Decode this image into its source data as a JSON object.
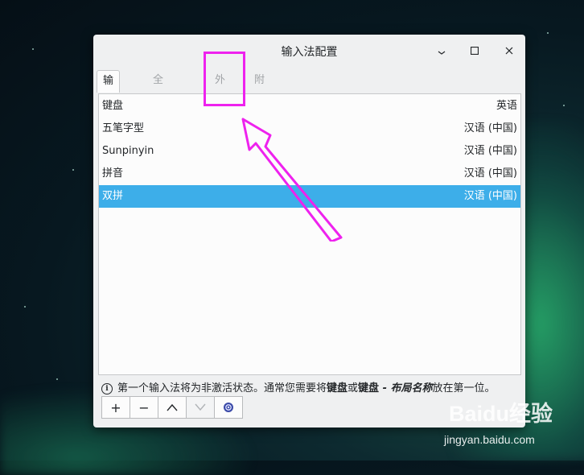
{
  "window": {
    "title": "输入法配置",
    "tabs": [
      {
        "label": "输入法"
      },
      {
        "label": "全局配置"
      },
      {
        "label": "外观"
      },
      {
        "label": "附加组件"
      }
    ]
  },
  "list": {
    "header": {
      "name": "键盘",
      "lang": "英语"
    },
    "rows": [
      {
        "name": "五笔字型",
        "lang": "汉语 (中国)"
      },
      {
        "name": "Sunpinyin",
        "lang": "汉语 (中国)"
      },
      {
        "name": "拼音",
        "lang": "汉语 (中国)"
      },
      {
        "name": "双拼",
        "lang": "汉语 (中国)",
        "selected": true
      }
    ]
  },
  "info": {
    "icon": "ⓘ",
    "text_a": "第一个输入法将为非激活状态。通常您需要将",
    "bold_a": "键盘",
    "text_b": "或",
    "bold_b": "键盘",
    "italic_bold": " - 布局名称",
    "text_c": "放在第一位。"
  },
  "toolbar": {
    "add": "+",
    "remove": "−",
    "up": "up-chevron-icon",
    "down": "down-chevron-icon",
    "configure": "configure-icon"
  },
  "watermark": {
    "logo": "Baidu经验",
    "url": "jingyan.baidu.com"
  },
  "colors": {
    "accent": "#3daee9",
    "annotation": "#ee22ee"
  }
}
